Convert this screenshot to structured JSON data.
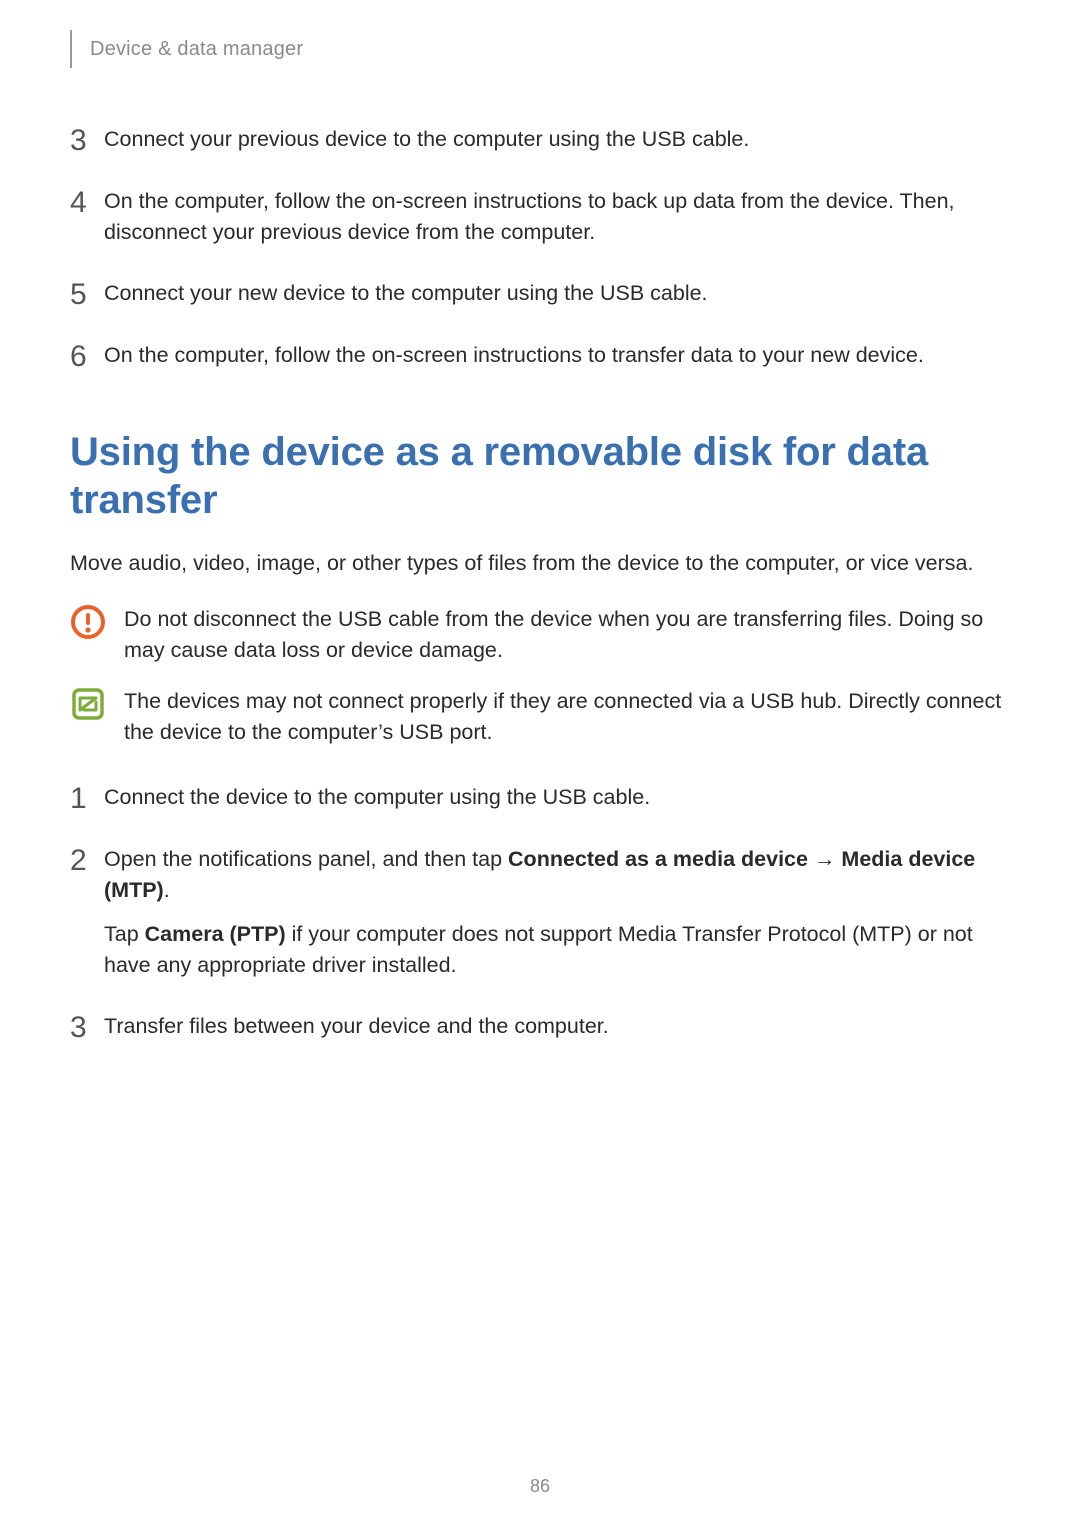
{
  "header": {
    "breadcrumb": "Device & data manager"
  },
  "topSteps": [
    {
      "num": "3",
      "paras": [
        {
          "runs": [
            {
              "t": "Connect your previous device to the computer using the USB cable."
            }
          ]
        }
      ]
    },
    {
      "num": "4",
      "paras": [
        {
          "runs": [
            {
              "t": "On the computer, follow the on-screen instructions to back up data from the device. Then, disconnect your previous device from the computer."
            }
          ]
        }
      ]
    },
    {
      "num": "5",
      "paras": [
        {
          "runs": [
            {
              "t": "Connect your new device to the computer using the USB cable."
            }
          ]
        }
      ]
    },
    {
      "num": "6",
      "paras": [
        {
          "runs": [
            {
              "t": "On the computer, follow the on-screen instructions to transfer data to your new device."
            }
          ]
        }
      ]
    }
  ],
  "section": {
    "title": "Using the device as a removable disk for data transfer",
    "intro": "Move audio, video, image, or other types of files from the device to the computer, or vice versa."
  },
  "callouts": [
    {
      "icon": "warning",
      "text": "Do not disconnect the USB cable from the device when you are transferring files. Doing so may cause data loss or device damage."
    },
    {
      "icon": "note",
      "text": "The devices may not connect properly if they are connected via a USB hub. Directly connect the device to the computer’s USB port."
    }
  ],
  "bottomSteps": [
    {
      "num": "1",
      "paras": [
        {
          "runs": [
            {
              "t": "Connect the device to the computer using the USB cable."
            }
          ]
        }
      ]
    },
    {
      "num": "2",
      "paras": [
        {
          "runs": [
            {
              "t": "Open the notifications panel, and then tap "
            },
            {
              "t": "Connected as a media device",
              "bold": true
            },
            {
              "t": " → "
            },
            {
              "t": "Media device (MTP)",
              "bold": true
            },
            {
              "t": "."
            }
          ]
        },
        {
          "runs": [
            {
              "t": "Tap "
            },
            {
              "t": "Camera (PTP)",
              "bold": true
            },
            {
              "t": " if your computer does not support Media Transfer Protocol (MTP) or not have any appropriate driver installed."
            }
          ]
        }
      ]
    },
    {
      "num": "3",
      "paras": [
        {
          "runs": [
            {
              "t": "Transfer files between your device and the computer."
            }
          ]
        }
      ]
    }
  ],
  "pageNumber": "86"
}
